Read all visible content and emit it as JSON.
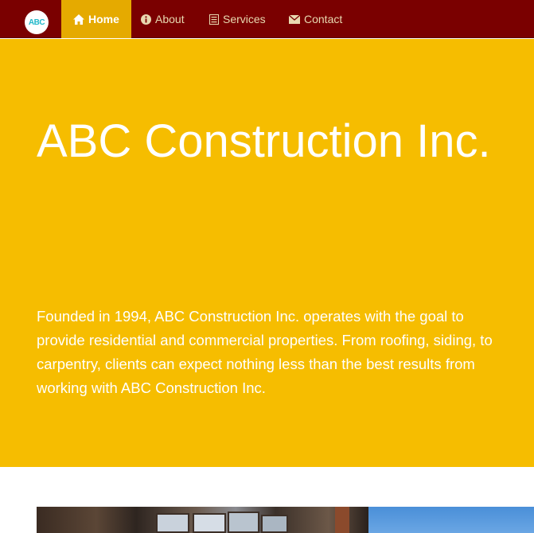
{
  "brand": {
    "logo_text": "ABC",
    "logo_color": "#22b8c9"
  },
  "nav": {
    "items": [
      {
        "label": "Home",
        "icon": "home-icon",
        "active": true
      },
      {
        "label": "About",
        "icon": "info-icon",
        "active": false
      },
      {
        "label": "Services",
        "icon": "list-icon",
        "active": false
      },
      {
        "label": "Contact",
        "icon": "envelope-icon",
        "active": false
      }
    ]
  },
  "hero": {
    "title": "ABC Construction Inc.",
    "description": "Founded in 1994, ABC Construction Inc. operates with the goal to provide residential and commercial properties. From roofing, siding, to carpentry, clients can expect nothing less than the best results from working with ABC Construction Inc."
  },
  "colors": {
    "navbar": "#7a0000",
    "nav_active": "#e5aa00",
    "hero_background": "#f6bd00",
    "text_light": "#ffffff"
  },
  "gallery": {
    "images": [
      {
        "subject": "interior-room-photo"
      },
      {
        "subject": "blue-sky-photo"
      }
    ]
  }
}
